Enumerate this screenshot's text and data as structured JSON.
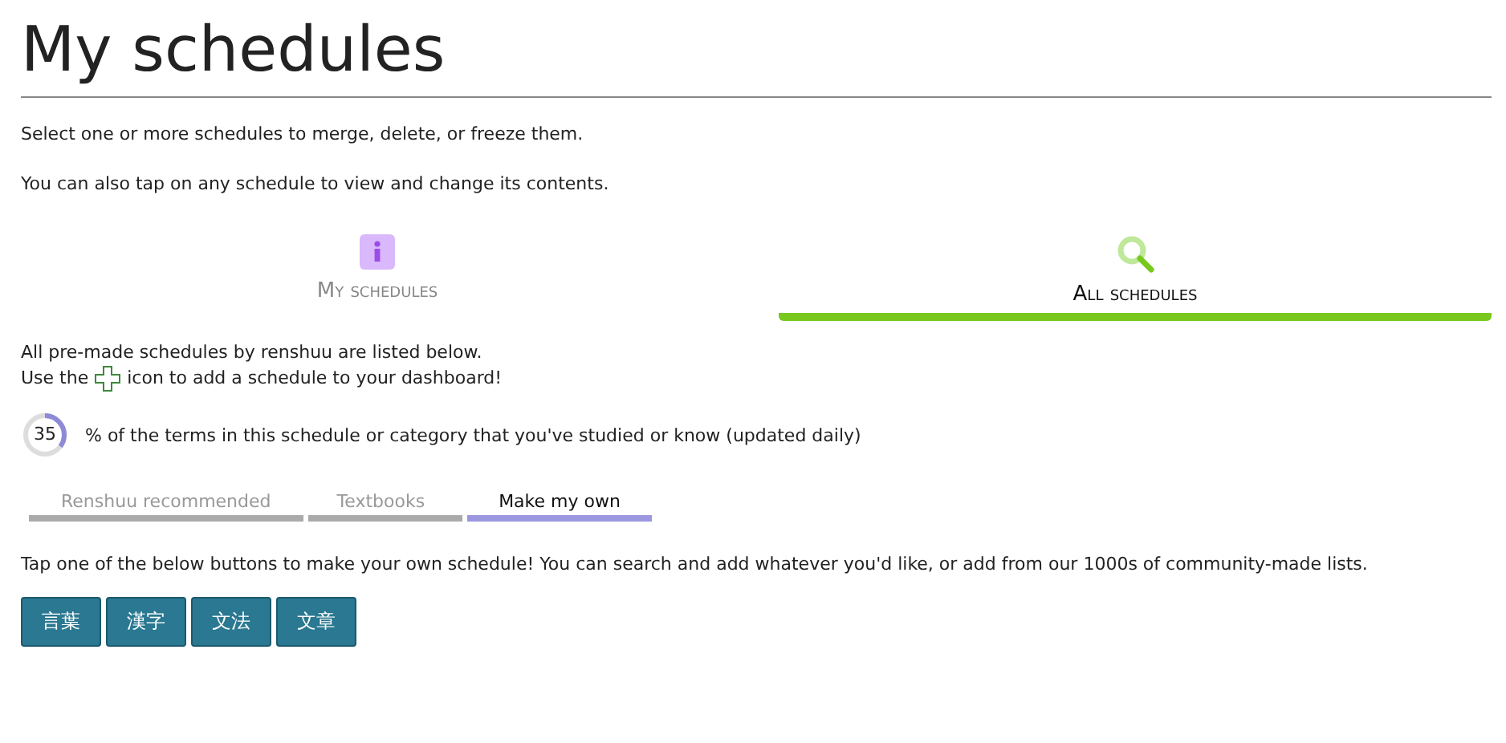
{
  "title": "My schedules",
  "intro": [
    "Select one or more schedules to merge, delete, or freeze them.",
    "You can also tap on any schedule to view and change its contents."
  ],
  "tabs": [
    {
      "label": "My schedules",
      "kind": "info",
      "selected": false
    },
    {
      "label": "All schedules",
      "kind": "search",
      "selected": true
    }
  ],
  "notice": {
    "line_1": "All pre-made schedules by renshuu are listed below.",
    "line_2_before": "Use the",
    "line_2_after": "icon to add a schedule to your dashboard!"
  },
  "legend": {
    "value": "35",
    "text": "% of the terms in this schedule or category that you've studied or know (updated daily)"
  },
  "subtabs": [
    {
      "label": "Renshuu recommended",
      "selected": false
    },
    {
      "label": "Textbooks",
      "selected": false
    },
    {
      "label": "Make my own",
      "selected": true
    }
  ],
  "instructions": "Tap one of the below buttons to make your own schedule! You can search and add whatever you'd like, or add from our 1000s of community-made lists.",
  "buttons": [
    "言葉",
    "漢字",
    "文法",
    "文章"
  ]
}
